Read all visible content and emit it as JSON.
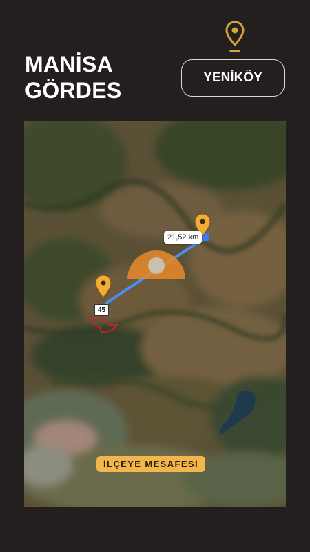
{
  "header": {
    "title_line1": "MANİSA",
    "title_line2": "GÖRDES",
    "village_button": "YENİKÖY"
  },
  "map": {
    "distance_label": "21,52 km",
    "road_number": "45",
    "footer_label": "İLÇEYE MESAFESİ",
    "markers": [
      "district-center-pin",
      "village-pin"
    ]
  },
  "colors": {
    "background": "#231f1e",
    "accent_gold": "#d4a33a",
    "badge": "#f2b64a",
    "route_line": "#4a8ef5",
    "boundary": "#c0262c"
  },
  "icons": {
    "header_pin": "map-pin-icon"
  }
}
